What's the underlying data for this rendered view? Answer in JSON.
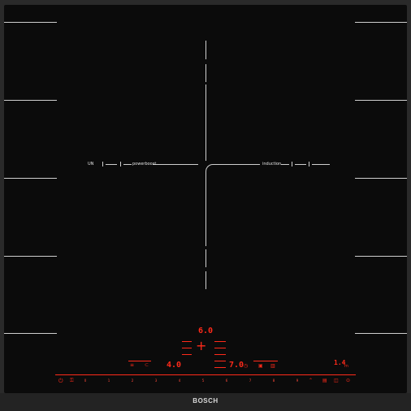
{
  "brand": "BOSCH",
  "accent_color": "#ff2a1a",
  "zone_labels": {
    "left": "UN",
    "center_left": "powerboost",
    "center_right": "induction"
  },
  "display": {
    "top_power": "6.0",
    "left_power": "4.0",
    "right_power": "7.0",
    "timer": "1.4"
  },
  "slider_ticks": [
    "0",
    "1",
    "2",
    "3",
    "4",
    "5",
    "6",
    "7",
    "8",
    "9"
  ],
  "icons": {
    "power": "power-icon",
    "child_lock": "child-lock-icon",
    "plus": "plus-icon",
    "timer": "timer-icon"
  }
}
